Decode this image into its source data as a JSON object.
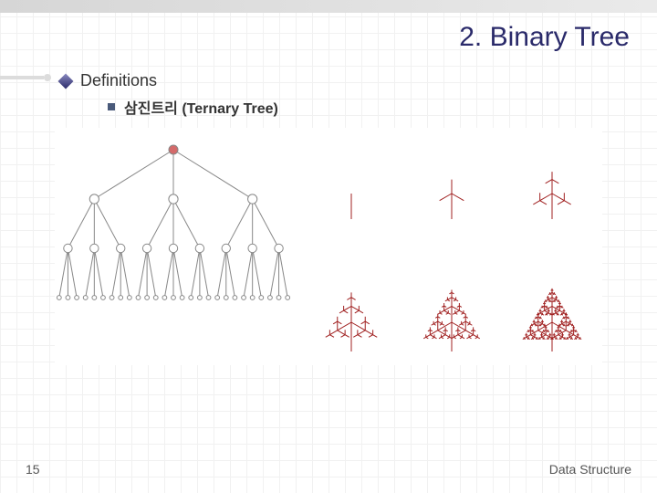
{
  "slide": {
    "title": "2. Binary Tree",
    "heading": "Definitions",
    "subheading": "삼진트리 (Ternary Tree)",
    "page_number": "15",
    "footer": "Data Structure"
  },
  "icons": {
    "diamond": "diamond-bullet-icon",
    "square": "square-bullet-icon"
  },
  "diagram": {
    "ternary_depth": 4,
    "fractal_levels": [
      1,
      2,
      3,
      4,
      5,
      6
    ]
  }
}
